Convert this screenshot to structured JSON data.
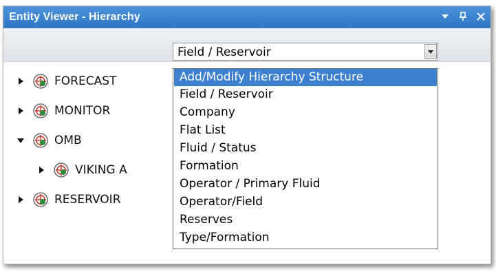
{
  "window": {
    "title": "Entity Viewer - Hierarchy",
    "pin_glyph": "ᵖ",
    "close_glyph": "✕"
  },
  "combo": {
    "value": "Field / Reservoir"
  },
  "tree": {
    "nodes": [
      {
        "label": "FORECAST",
        "expanded": false
      },
      {
        "label": "MONITOR",
        "expanded": false
      },
      {
        "label": "OMB",
        "expanded": true
      },
      {
        "label": "VIKING A",
        "expanded": false
      },
      {
        "label": "RESERVOIR",
        "expanded": false
      }
    ]
  },
  "dropdown": {
    "items": [
      "Add/Modify Hierarchy Structure",
      "Field / Reservoir",
      "Company",
      "Flat List",
      "Fluid / Status",
      "Formation",
      "Operator / Primary Fluid",
      "Operator/Field",
      "Reserves",
      "Type/Formation"
    ],
    "highlighted_index": 0
  },
  "colors": {
    "titlebar": "#2f77c3",
    "selection": "#3d80cf",
    "entity_icon_green": "#2e8b3a",
    "entity_icon_red": "#c0392b"
  }
}
